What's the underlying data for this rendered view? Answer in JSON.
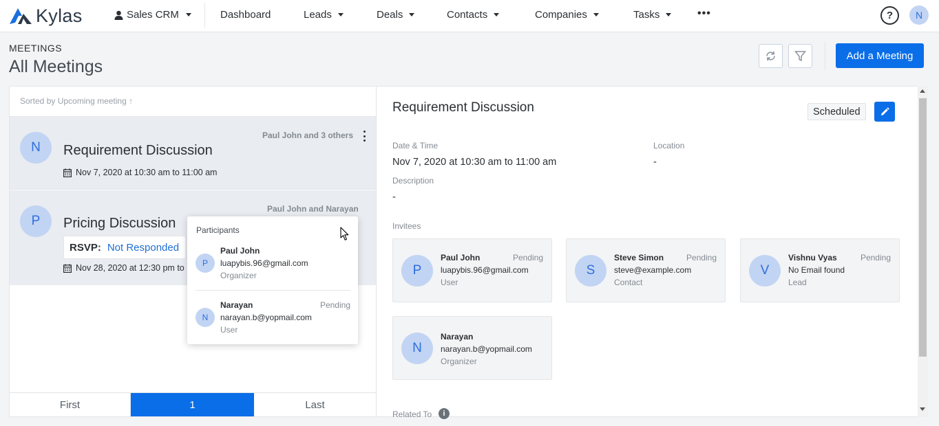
{
  "app": {
    "logo_text": "Kylas"
  },
  "nav": {
    "workspace": "Sales CRM",
    "items": [
      {
        "label": "Dashboard",
        "has_caret": false
      },
      {
        "label": "Leads",
        "has_caret": true
      },
      {
        "label": "Deals",
        "has_caret": true
      },
      {
        "label": "Contacts",
        "has_caret": true
      },
      {
        "label": "Companies",
        "has_caret": true
      },
      {
        "label": "Tasks",
        "has_caret": true
      }
    ],
    "more": "•••",
    "help": "?",
    "user_initial": "N"
  },
  "header": {
    "section": "MEETINGS",
    "title": "All Meetings",
    "add_button": "Add a Meeting"
  },
  "list": {
    "sorted_label": "Sorted by",
    "sorted_value": "Upcoming meeting ↑",
    "meetings": [
      {
        "initial": "N",
        "title": "Requirement Discussion",
        "participants": "Paul John and 3 others",
        "date": "Nov 7, 2020 at 10:30 am to 11:00 am"
      },
      {
        "initial": "P",
        "title": "Pricing Discussion",
        "participants": "Paul John and Narayan",
        "rsvp_label": "RSVP:",
        "rsvp_value": "Not Responded",
        "date": "Nov 28, 2020 at 12:30 pm to 1"
      }
    ],
    "pager": {
      "first": "First",
      "current": "1",
      "last": "Last"
    }
  },
  "popup": {
    "heading": "Participants",
    "participants": [
      {
        "initial": "P",
        "name": "Paul John",
        "email": "luapybis.96@gmail.com",
        "role": "Organizer",
        "status": ""
      },
      {
        "initial": "N",
        "name": "Narayan",
        "email": "narayan.b@yopmail.com",
        "role": "User",
        "status": "Pending"
      }
    ]
  },
  "detail": {
    "title": "Requirement Discussion",
    "status": "Scheduled",
    "date_label": "Date & Time",
    "date_value": "Nov 7, 2020 at 10:30 am to 11:00 am",
    "location_label": "Location",
    "location_value": "-",
    "description_label": "Description",
    "description_value": "-",
    "invitees_label": "Invitees",
    "invitees": [
      {
        "initial": "P",
        "name": "Paul John",
        "status": "Pending",
        "email": "luapybis.96@gmail.com",
        "role": "User"
      },
      {
        "initial": "S",
        "name": "Steve Simon",
        "status": "Pending",
        "email": "steve@example.com",
        "role": "Contact"
      },
      {
        "initial": "V",
        "name": "Vishnu Vyas",
        "status": "Pending",
        "email": "No Email found",
        "role": "Lead"
      },
      {
        "initial": "N",
        "name": "Narayan",
        "status": "",
        "email": "narayan.b@yopmail.com",
        "role": "Organizer"
      }
    ],
    "related_label": "Related To",
    "info_icon": "i"
  },
  "colors": {
    "primary": "#0a6ee8",
    "avatar_bg": "#c2d4f3",
    "avatar_text": "#2d6fdc"
  }
}
